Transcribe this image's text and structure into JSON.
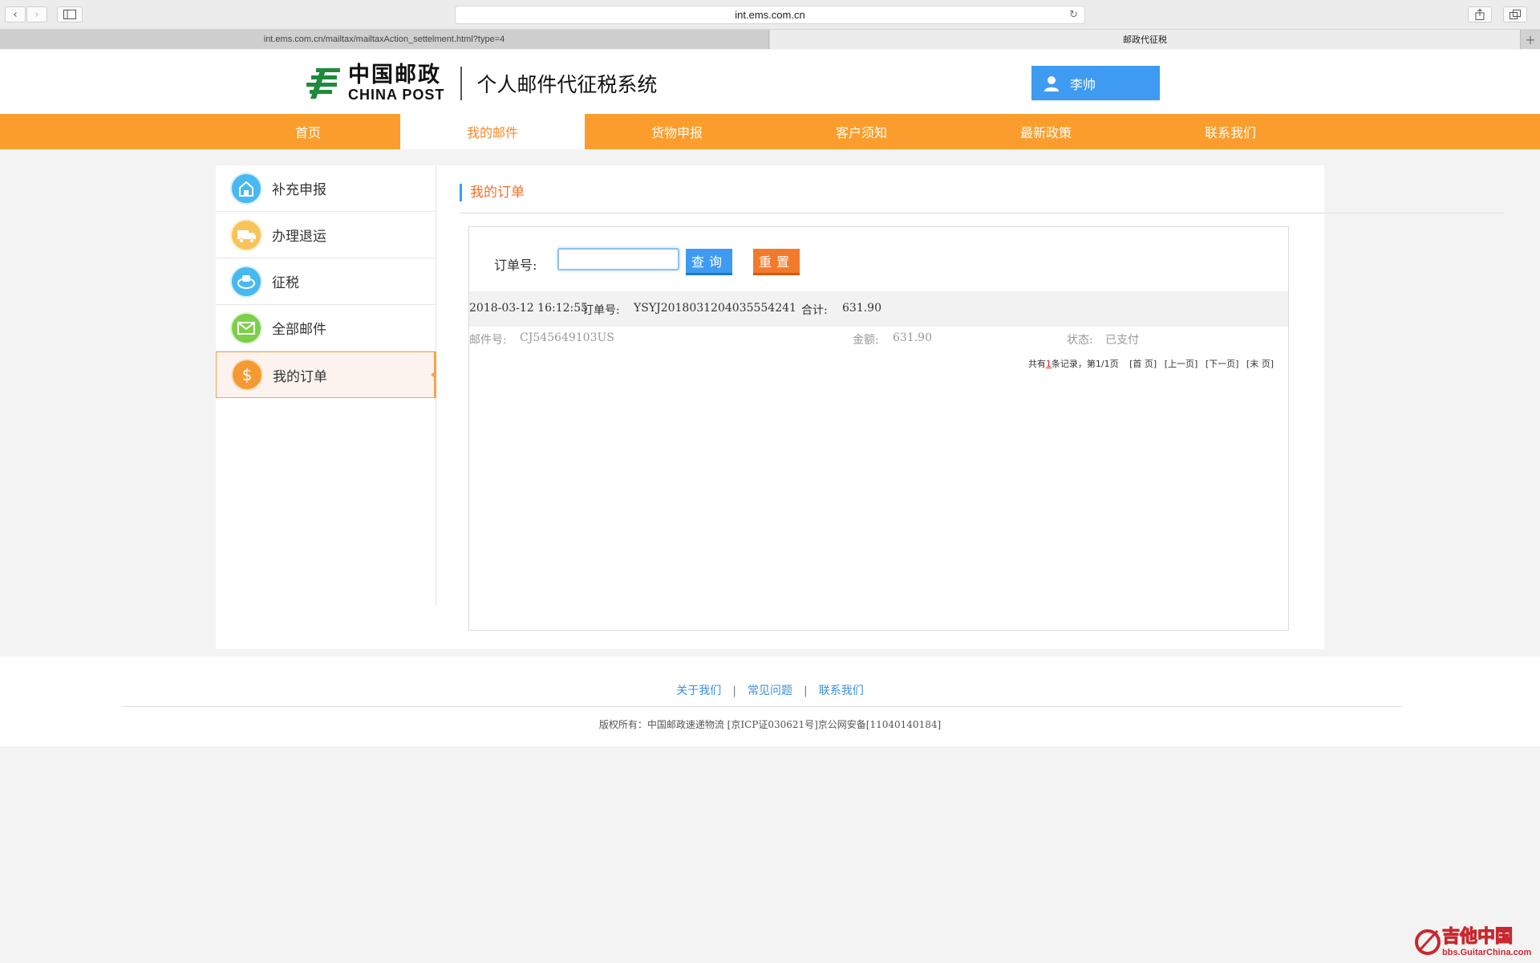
{
  "browser": {
    "url": "int.ems.com.cn",
    "tabs": [
      {
        "label": "int.ems.com.cn/mailtax/mailtaxAction_settelment.html?type=4"
      },
      {
        "label": "邮政代征税"
      }
    ]
  },
  "header": {
    "logo_cn": "中国邮政",
    "logo_en": "CHINA POST",
    "system_title": "个人邮件代征税系统",
    "user_name": "李帅",
    "brand_green": "#1f8a3b",
    "accent_blue": "#3f9bf2"
  },
  "nav": {
    "accent_orange": "#fb9d2c",
    "items": [
      {
        "label": "首页"
      },
      {
        "label": "我的邮件"
      },
      {
        "label": "货物申报"
      },
      {
        "label": "客户须知"
      },
      {
        "label": "最新政策"
      },
      {
        "label": "联系我们"
      }
    ],
    "active_index": 1
  },
  "sidebar": {
    "items": [
      {
        "label": "补充申报",
        "icon": "building-icon",
        "color": "#48b8f0"
      },
      {
        "label": "办理退运",
        "icon": "truck-icon",
        "color": "#f8c35a"
      },
      {
        "label": "征税",
        "icon": "tax-stamp-icon",
        "color": "#48b8f0"
      },
      {
        "label": "全部邮件",
        "icon": "envelope-icon",
        "color": "#7ccf47"
      },
      {
        "label": "我的订单",
        "icon": "dollar-icon",
        "color": "#f59a33"
      }
    ],
    "active_index": 4
  },
  "main": {
    "section_title": "我的订单",
    "search": {
      "label": "订单号:",
      "value": "",
      "query_label": "查询",
      "reset_label": "重置"
    },
    "order": {
      "datetime": "2018-03-12 16:12:55",
      "order_no_label": "订单号:",
      "order_no": "YSYJ2018031204035554241",
      "total_label": "合计:",
      "total": "631.90",
      "mail_no_label": "邮件号:",
      "mail_no": "CJ545649103US",
      "amount_label": "金额:",
      "amount": "631.90",
      "status_label": "状态:",
      "status": "已支付"
    },
    "pager": {
      "prefix": "共有",
      "count": "1",
      "suffix": "条记录，第1/1页",
      "first": "[首 页]",
      "prev": "[上一页]",
      "next": "[下一页]",
      "last": "[末 页]"
    }
  },
  "footer": {
    "links": [
      {
        "label": "关于我们"
      },
      {
        "label": "常见问题"
      },
      {
        "label": "联系我们"
      }
    ],
    "copyright": "版权所有：中国邮政速递物流 [京ICP证030621号]京公网安备[11040140184]"
  },
  "watermark": {
    "text_cn": "吉他中国",
    "text_url": "bbs.GuitarChina.com"
  }
}
